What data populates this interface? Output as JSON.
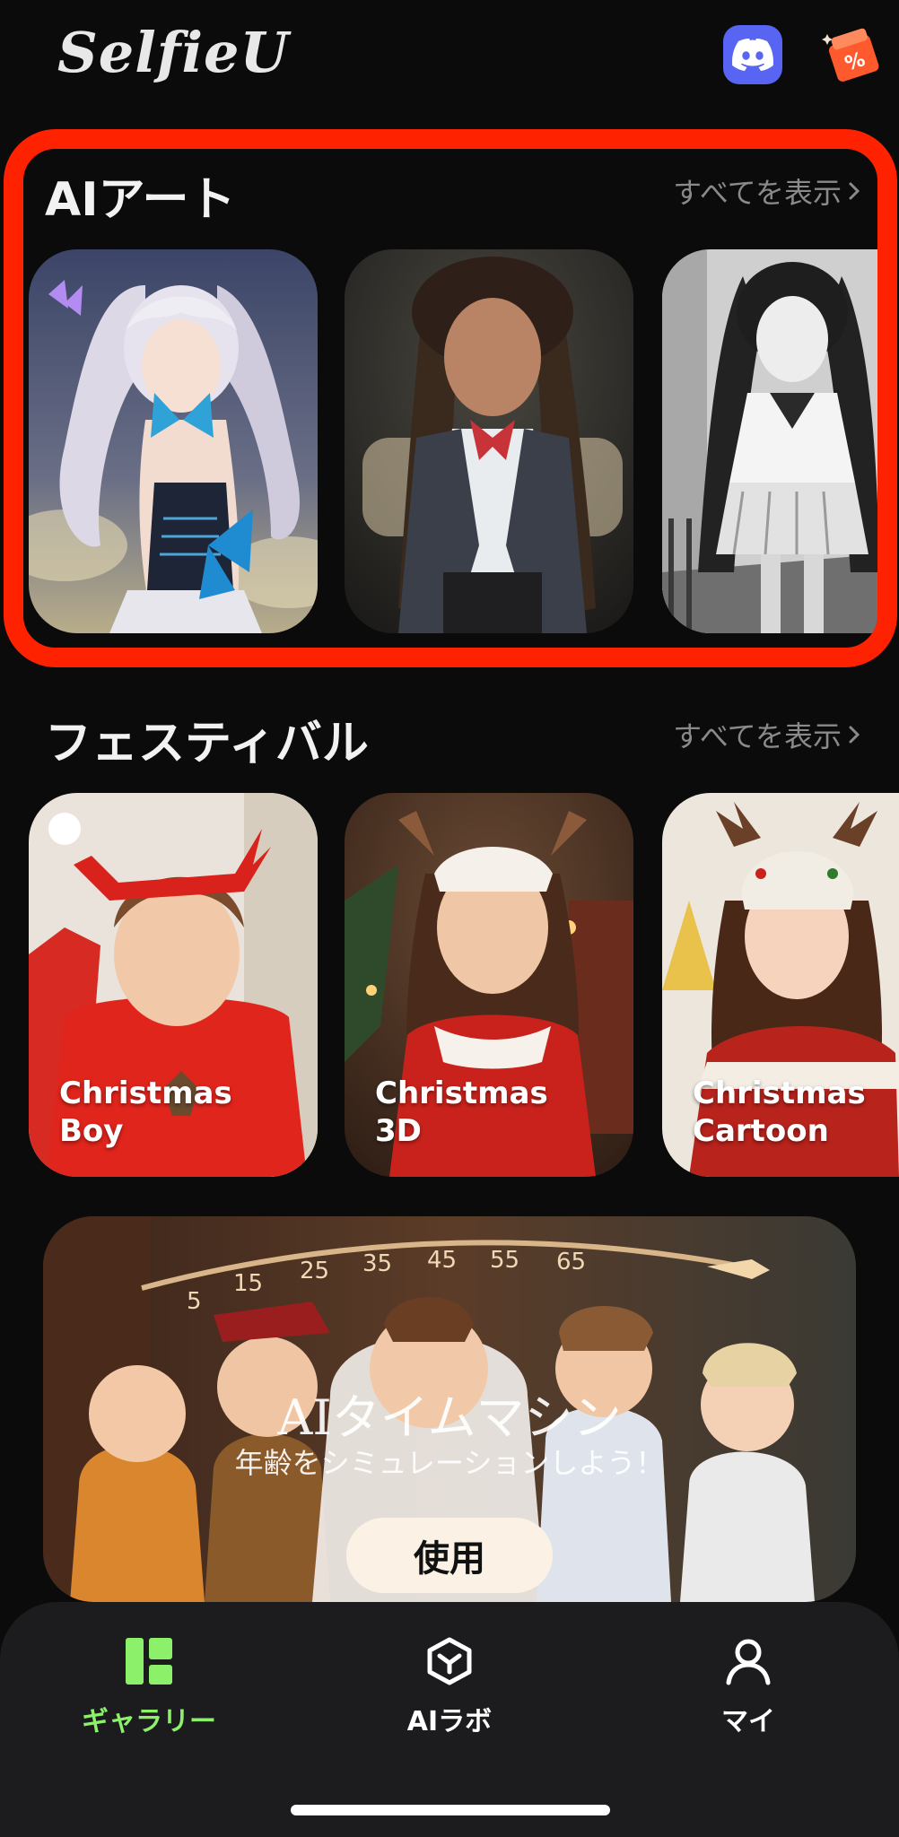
{
  "app": {
    "logo_text": "SelfieU"
  },
  "header": {
    "discord_icon": "discord-icon",
    "promo_icon": "discount-ticket-icon",
    "promo_badge": "%"
  },
  "sections": {
    "ai_art": {
      "title": "AIアート",
      "see_all": "すべてを表示",
      "cards": [
        {
          "label": "",
          "image": "anime-elf-girl-with-butterflies"
        },
        {
          "label": "",
          "image": "anime-girl-with-braids-in-uniform"
        },
        {
          "label": "",
          "image": "monochrome-anime-schoolgirl"
        }
      ]
    },
    "festival": {
      "title": "フェスティバル",
      "see_all": "すべてを表示",
      "cards": [
        {
          "line1": "Christmas",
          "line2": "Boy"
        },
        {
          "line1": "Christmas",
          "line2": "3D"
        },
        {
          "line1": "Christmas",
          "line2": "Cartoon"
        }
      ]
    }
  },
  "banner": {
    "title": "AIタイムマシン",
    "subtitle": "年齢をシミュレーションしよう！",
    "button_label": "使用",
    "age_ticks": [
      "5",
      "15",
      "25",
      "35",
      "45",
      "55",
      "65"
    ]
  },
  "tabbar": {
    "items": [
      {
        "label": "ギャラリー",
        "icon": "gallery-icon",
        "active": true
      },
      {
        "label": "AIラボ",
        "icon": "cube-icon",
        "active": false
      },
      {
        "label": "マイ",
        "icon": "person-icon",
        "active": false
      }
    ]
  },
  "colors": {
    "accent": "#8df06b",
    "highlight": "#ff2200",
    "discord": "#5865f2",
    "promo": "#ff5a2e"
  }
}
